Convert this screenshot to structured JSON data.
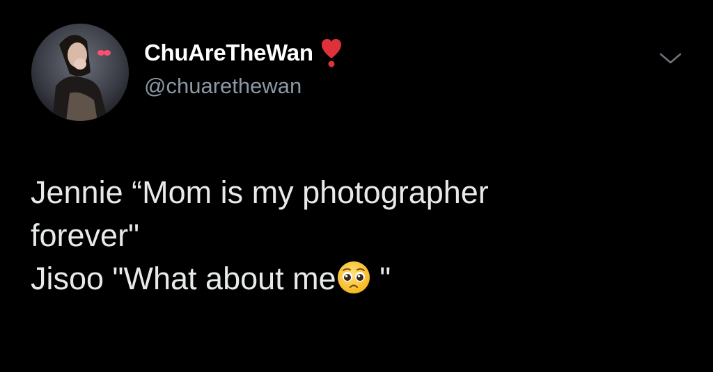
{
  "tweet": {
    "author": {
      "display_name": "ChuAreTheWan",
      "handle": "@chuarethewan",
      "badge_icon": "heavy-heart-exclamation-icon",
      "avatar": "avatar-photo"
    },
    "menu_icon": "chevron-down-icon",
    "text_lines": [
      "Jennie “Mom is my photographer",
      "forever\"",
      "Jisoo \"What about me"
    ],
    "line3_suffix": " \"",
    "emoji": "pleading-face-emoji",
    "colors": {
      "background": "#000000",
      "display_name": "#ffffff",
      "handle": "#8b98a5",
      "text": "#e7e9ea",
      "badge": "#e0313b"
    }
  }
}
